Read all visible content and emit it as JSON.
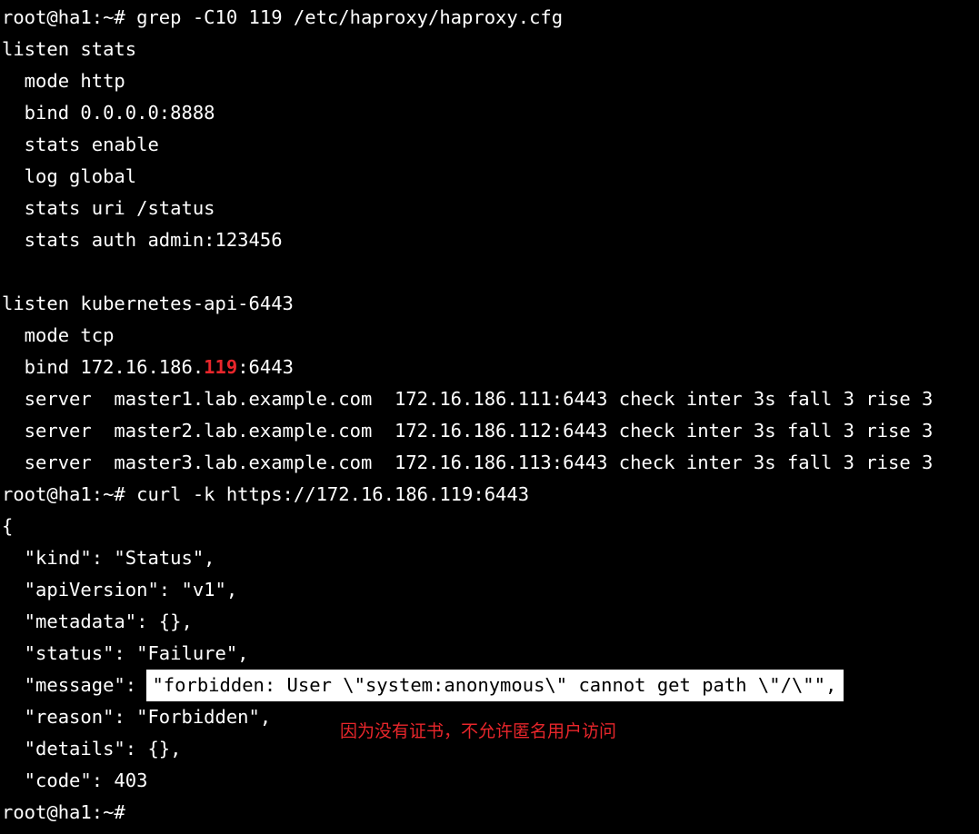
{
  "terminal": {
    "lines": [
      "root@ha1:~# grep -C10 119 /etc/haproxy/haproxy.cfg",
      "listen stats",
      "  mode http",
      "  bind 0.0.0.0:8888",
      "  stats enable",
      "  log global",
      "  stats uri /status",
      "  stats auth admin:123456",
      "",
      "listen kubernetes-api-6443",
      "  mode tcp"
    ],
    "bind_prefix": "  bind 172.16.186.",
    "bind_match": "119",
    "bind_suffix": ":6443",
    "lines_after_bind": [
      "  server  master1.lab.example.com  172.16.186.111:6443 check inter 3s fall 3 rise 3",
      "  server  master2.lab.example.com  172.16.186.112:6443 check inter 3s fall 3 rise 3",
      "  server  master3.lab.example.com  172.16.186.113:6443 check inter 3s fall 3 rise 3",
      "root@ha1:~# curl -k https://172.16.186.119:6443",
      "{",
      "  \"kind\": \"Status\",",
      "  \"apiVersion\": \"v1\",",
      "  \"metadata\": {},",
      "  \"status\": \"Failure\","
    ],
    "message_key": "  \"message\": ",
    "message_value": "\"forbidden: User \\\"system:anonymous\\\" cannot get path \\\"/\\\"\",",
    "lines_after_message": [
      "  \"reason\": \"Forbidden\",",
      "  \"details\": {},",
      "  \"code\": 403"
    ],
    "final_prompt": "root@ha1:~# "
  },
  "annotation": "因为没有证书，不允许匿名用户访问",
  "colors": {
    "background": "#000000",
    "foreground": "#ffffff",
    "match_highlight": "#e8262b",
    "annotation": "#e8262b",
    "highlight_box": "#ffffff"
  }
}
